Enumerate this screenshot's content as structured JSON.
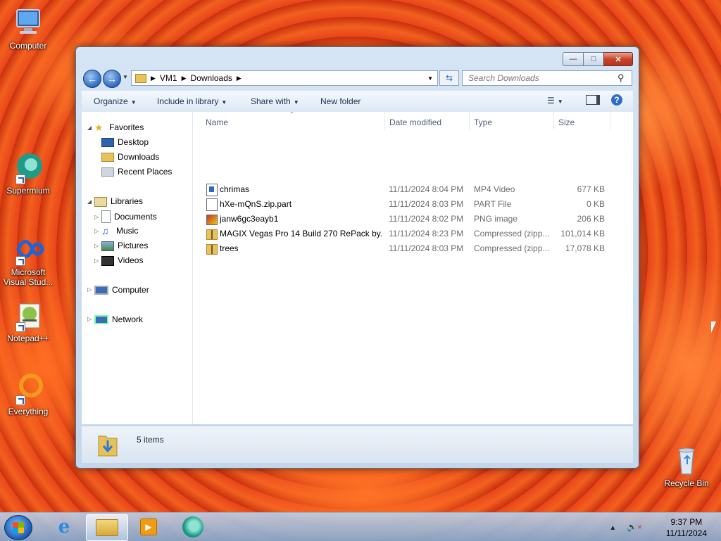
{
  "desktop": {
    "icons": [
      {
        "label": "Computer"
      },
      {
        "label": "Supermium"
      },
      {
        "label": "Microsoft Visual Stud..."
      },
      {
        "label": "Notepad++"
      },
      {
        "label": "Everything"
      },
      {
        "label": "Recycle Bin"
      }
    ]
  },
  "window": {
    "breadcrumb": [
      "VM1",
      "Downloads"
    ],
    "search_placeholder": "Search Downloads",
    "commands": {
      "organize": "Organize",
      "include_in_library": "Include in library",
      "share_with": "Share with",
      "new_folder": "New folder"
    },
    "nav": {
      "favorites": "Favorites",
      "desktop": "Desktop",
      "downloads": "Downloads",
      "recent_places": "Recent Places",
      "libraries": "Libraries",
      "documents": "Documents",
      "music": "Music",
      "pictures": "Pictures",
      "videos": "Videos",
      "computer": "Computer",
      "network": "Network"
    },
    "columns": {
      "name": "Name",
      "date_modified": "Date modified",
      "type": "Type",
      "size": "Size"
    },
    "files": [
      {
        "name": "chrimas",
        "date": "11/11/2024 8:04 PM",
        "type": "MP4 Video",
        "size": "677 KB",
        "icon": "video-file-icon"
      },
      {
        "name": "hXe-mQnS.zip.part",
        "date": "11/11/2024 8:03 PM",
        "type": "PART File",
        "size": "0 KB",
        "icon": "blank-file-icon"
      },
      {
        "name": "janw6gc3eayb1",
        "date": "11/11/2024 8:02 PM",
        "type": "PNG image",
        "size": "206 KB",
        "icon": "image-file-icon"
      },
      {
        "name": "MAGIX Vegas Pro 14 Build 270 RePack by...",
        "date": "11/11/2024 8:23 PM",
        "type": "Compressed (zipp...",
        "size": "101,014 KB",
        "icon": "zip-folder-icon"
      },
      {
        "name": "trees",
        "date": "11/11/2024 8:03 PM",
        "type": "Compressed (zipp...",
        "size": "17,078 KB",
        "icon": "zip-folder-icon"
      }
    ],
    "status": {
      "item_count": "5 items"
    }
  },
  "taskbar": {
    "time": "9:37 PM",
    "date": "11/11/2024"
  }
}
